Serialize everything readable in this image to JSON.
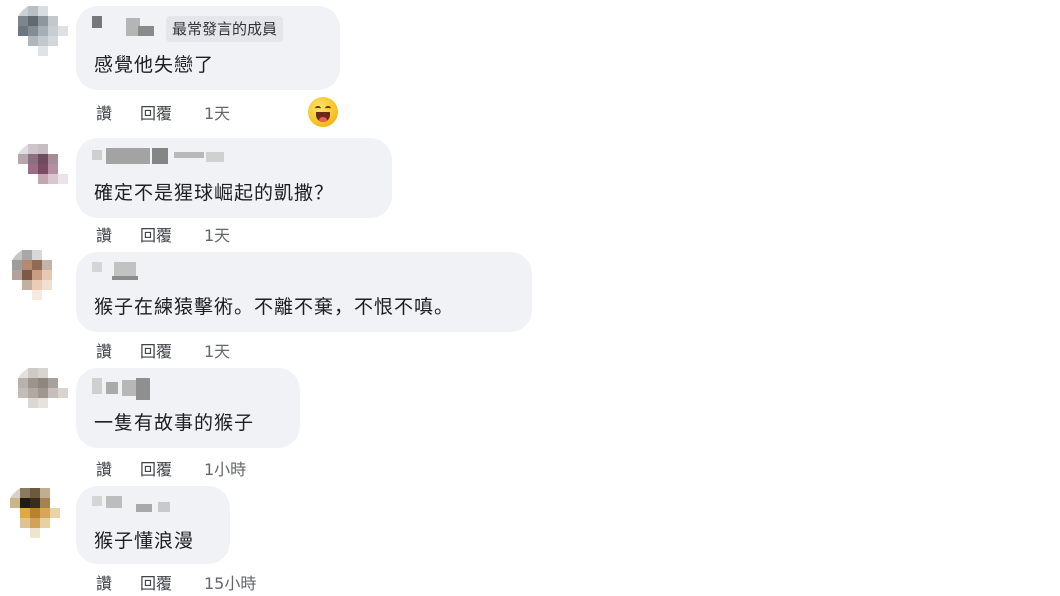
{
  "comments": [
    {
      "badge": "最常發言的成員",
      "text": "感覺他失戀了",
      "actions": {
        "like": "讚",
        "reply": "回覆",
        "time": "1天"
      },
      "reaction": "laughing-emoji-icon"
    },
    {
      "text": "確定不是猩球崛起的凱撒？",
      "actions": {
        "like": "讚",
        "reply": "回覆",
        "time": "1天"
      }
    },
    {
      "text": "猴子在練猿擊術。不離不棄，不恨不嗔。",
      "actions": {
        "like": "讚",
        "reply": "回覆",
        "time": "1天"
      }
    },
    {
      "text": "一隻有故事的猴子",
      "actions": {
        "like": "讚",
        "reply": "回覆",
        "time": "1小時"
      }
    },
    {
      "text": "猴子懂浪漫",
      "actions": {
        "like": "讚",
        "reply": "回覆",
        "time": "15小時"
      }
    }
  ],
  "colors": {
    "bubble": "#f0f2f5",
    "text": "#1c1e21",
    "meta": "#65676b"
  }
}
